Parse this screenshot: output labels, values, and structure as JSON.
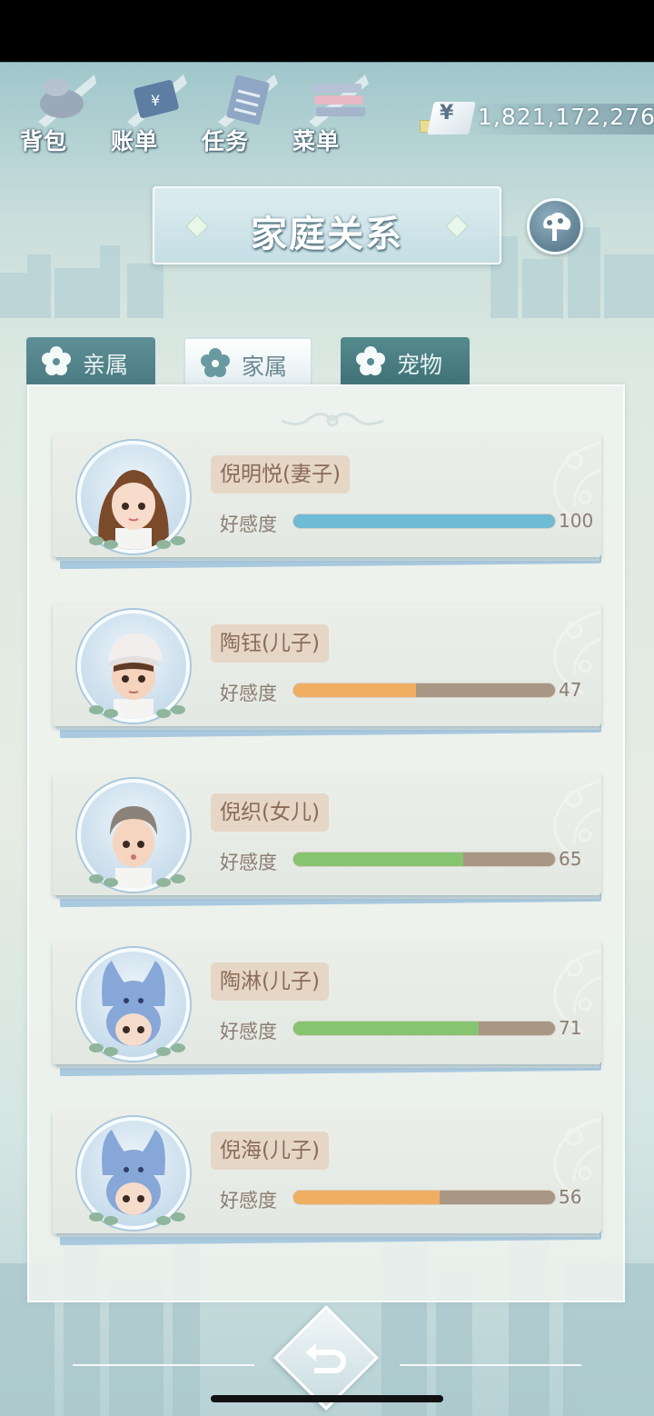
{
  "top_menu": {
    "items": [
      {
        "label": "背包",
        "icon": "bag-icon"
      },
      {
        "label": "账单",
        "icon": "bill-icon"
      },
      {
        "label": "任务",
        "icon": "task-icon"
      },
      {
        "label": "菜单",
        "icon": "menu-icon"
      }
    ]
  },
  "currency": {
    "symbol": "¥",
    "amount": "1,821,172,276"
  },
  "header": {
    "title": "家庭关系",
    "tree_button_icon": "family-tree-icon"
  },
  "tabs": [
    {
      "label": "亲属",
      "active": false
    },
    {
      "label": "家属",
      "active": true
    },
    {
      "label": "宠物",
      "active": false
    }
  ],
  "members": [
    {
      "name": "倪明悦(妻子)",
      "affinity_label": "好感度",
      "affinity": 100,
      "bar_color": "#6ebbd6"
    },
    {
      "name": "陶钰(儿子)",
      "affinity_label": "好感度",
      "affinity": 47,
      "bar_color": "#f0ae62"
    },
    {
      "name": "倪织(女儿)",
      "affinity_label": "好感度",
      "affinity": 65,
      "bar_color": "#86c46f"
    },
    {
      "name": "陶淋(儿子)",
      "affinity_label": "好感度",
      "affinity": 71,
      "bar_color": "#86c46f"
    },
    {
      "name": "倪海(儿子)",
      "affinity_label": "好感度",
      "affinity": 56,
      "bar_color": "#f0ae62"
    }
  ],
  "footer": {
    "back_icon": "back-arrow-icon"
  }
}
